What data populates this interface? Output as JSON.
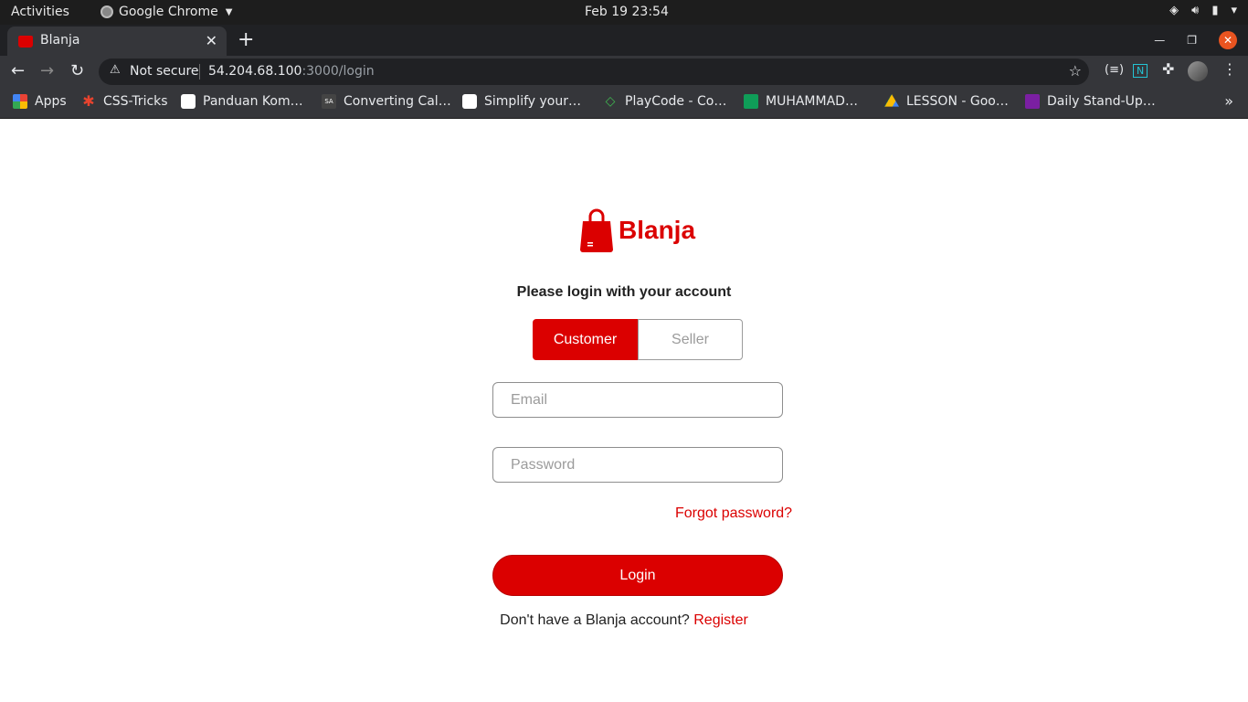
{
  "os_bar": {
    "activities": "Activities",
    "app_name": "Google Chrome",
    "clock": "Feb 19  23:54"
  },
  "browser": {
    "tab_title": "Blanja",
    "omnibox": {
      "security": "Not secure",
      "url_host": "54.204.68.100",
      "url_path": ":3000/login"
    },
    "bookmarks": [
      {
        "label": "Apps",
        "icon": "apps-grid-icon",
        "color": "#4285f4"
      },
      {
        "label": "CSS-Tricks",
        "icon": "css-tricks-icon",
        "color": "#e8432e"
      },
      {
        "label": "Panduan Kom…",
        "icon": "medium-icon",
        "color": "#ffffff"
      },
      {
        "label": "Converting Cal…",
        "icon": "site-icon",
        "color": "#444444"
      },
      {
        "label": "Simplify your…",
        "icon": "medium-icon",
        "color": "#ffffff"
      },
      {
        "label": "PlayCode - Co…",
        "icon": "playcode-icon",
        "color": "#3fb950"
      },
      {
        "label": "MUHAMMAD…",
        "icon": "sheets-icon",
        "color": "#0f9d58"
      },
      {
        "label": "LESSON - Goo…",
        "icon": "drive-icon",
        "color": "#fbbc04"
      },
      {
        "label": "Daily Stand-Up…",
        "icon": "forms-icon",
        "color": "#7b1fa2"
      }
    ]
  },
  "login": {
    "brand": "Blanja",
    "heading": "Please login with your account",
    "tabs": {
      "customer": "Customer",
      "seller": "Seller"
    },
    "email_placeholder": "Email",
    "password_placeholder": "Password",
    "forgot": "Forgot password?",
    "login_button": "Login",
    "register_prompt": "Don't have a Blanja account?",
    "register_link": "Register"
  },
  "colors": {
    "brand_red": "#db0000"
  }
}
